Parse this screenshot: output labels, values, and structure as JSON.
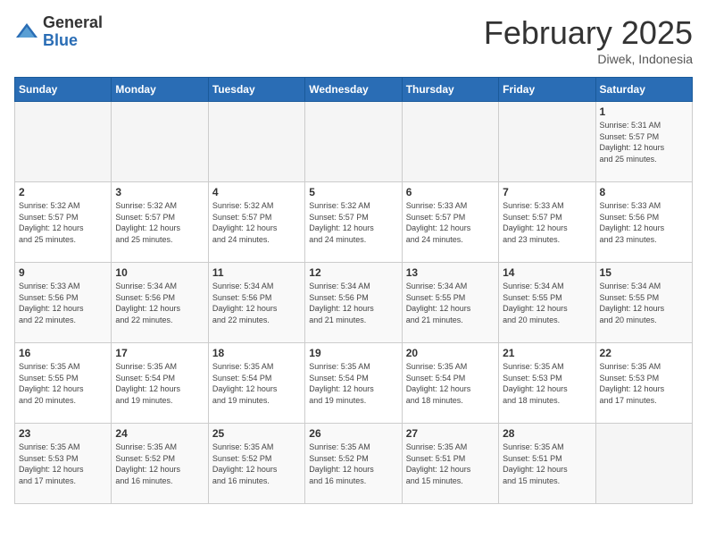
{
  "header": {
    "logo_general": "General",
    "logo_blue": "Blue",
    "title": "February 2025",
    "subtitle": "Diwek, Indonesia"
  },
  "weekdays": [
    "Sunday",
    "Monday",
    "Tuesday",
    "Wednesday",
    "Thursday",
    "Friday",
    "Saturday"
  ],
  "weeks": [
    [
      {
        "day": "",
        "info": ""
      },
      {
        "day": "",
        "info": ""
      },
      {
        "day": "",
        "info": ""
      },
      {
        "day": "",
        "info": ""
      },
      {
        "day": "",
        "info": ""
      },
      {
        "day": "",
        "info": ""
      },
      {
        "day": "1",
        "info": "Sunrise: 5:31 AM\nSunset: 5:57 PM\nDaylight: 12 hours\nand 25 minutes."
      }
    ],
    [
      {
        "day": "2",
        "info": "Sunrise: 5:32 AM\nSunset: 5:57 PM\nDaylight: 12 hours\nand 25 minutes."
      },
      {
        "day": "3",
        "info": "Sunrise: 5:32 AM\nSunset: 5:57 PM\nDaylight: 12 hours\nand 25 minutes."
      },
      {
        "day": "4",
        "info": "Sunrise: 5:32 AM\nSunset: 5:57 PM\nDaylight: 12 hours\nand 24 minutes."
      },
      {
        "day": "5",
        "info": "Sunrise: 5:32 AM\nSunset: 5:57 PM\nDaylight: 12 hours\nand 24 minutes."
      },
      {
        "day": "6",
        "info": "Sunrise: 5:33 AM\nSunset: 5:57 PM\nDaylight: 12 hours\nand 24 minutes."
      },
      {
        "day": "7",
        "info": "Sunrise: 5:33 AM\nSunset: 5:57 PM\nDaylight: 12 hours\nand 23 minutes."
      },
      {
        "day": "8",
        "info": "Sunrise: 5:33 AM\nSunset: 5:56 PM\nDaylight: 12 hours\nand 23 minutes."
      }
    ],
    [
      {
        "day": "9",
        "info": "Sunrise: 5:33 AM\nSunset: 5:56 PM\nDaylight: 12 hours\nand 22 minutes."
      },
      {
        "day": "10",
        "info": "Sunrise: 5:34 AM\nSunset: 5:56 PM\nDaylight: 12 hours\nand 22 minutes."
      },
      {
        "day": "11",
        "info": "Sunrise: 5:34 AM\nSunset: 5:56 PM\nDaylight: 12 hours\nand 22 minutes."
      },
      {
        "day": "12",
        "info": "Sunrise: 5:34 AM\nSunset: 5:56 PM\nDaylight: 12 hours\nand 21 minutes."
      },
      {
        "day": "13",
        "info": "Sunrise: 5:34 AM\nSunset: 5:55 PM\nDaylight: 12 hours\nand 21 minutes."
      },
      {
        "day": "14",
        "info": "Sunrise: 5:34 AM\nSunset: 5:55 PM\nDaylight: 12 hours\nand 20 minutes."
      },
      {
        "day": "15",
        "info": "Sunrise: 5:34 AM\nSunset: 5:55 PM\nDaylight: 12 hours\nand 20 minutes."
      }
    ],
    [
      {
        "day": "16",
        "info": "Sunrise: 5:35 AM\nSunset: 5:55 PM\nDaylight: 12 hours\nand 20 minutes."
      },
      {
        "day": "17",
        "info": "Sunrise: 5:35 AM\nSunset: 5:54 PM\nDaylight: 12 hours\nand 19 minutes."
      },
      {
        "day": "18",
        "info": "Sunrise: 5:35 AM\nSunset: 5:54 PM\nDaylight: 12 hours\nand 19 minutes."
      },
      {
        "day": "19",
        "info": "Sunrise: 5:35 AM\nSunset: 5:54 PM\nDaylight: 12 hours\nand 19 minutes."
      },
      {
        "day": "20",
        "info": "Sunrise: 5:35 AM\nSunset: 5:54 PM\nDaylight: 12 hours\nand 18 minutes."
      },
      {
        "day": "21",
        "info": "Sunrise: 5:35 AM\nSunset: 5:53 PM\nDaylight: 12 hours\nand 18 minutes."
      },
      {
        "day": "22",
        "info": "Sunrise: 5:35 AM\nSunset: 5:53 PM\nDaylight: 12 hours\nand 17 minutes."
      }
    ],
    [
      {
        "day": "23",
        "info": "Sunrise: 5:35 AM\nSunset: 5:53 PM\nDaylight: 12 hours\nand 17 minutes."
      },
      {
        "day": "24",
        "info": "Sunrise: 5:35 AM\nSunset: 5:52 PM\nDaylight: 12 hours\nand 16 minutes."
      },
      {
        "day": "25",
        "info": "Sunrise: 5:35 AM\nSunset: 5:52 PM\nDaylight: 12 hours\nand 16 minutes."
      },
      {
        "day": "26",
        "info": "Sunrise: 5:35 AM\nSunset: 5:52 PM\nDaylight: 12 hours\nand 16 minutes."
      },
      {
        "day": "27",
        "info": "Sunrise: 5:35 AM\nSunset: 5:51 PM\nDaylight: 12 hours\nand 15 minutes."
      },
      {
        "day": "28",
        "info": "Sunrise: 5:35 AM\nSunset: 5:51 PM\nDaylight: 12 hours\nand 15 minutes."
      },
      {
        "day": "",
        "info": ""
      }
    ]
  ]
}
